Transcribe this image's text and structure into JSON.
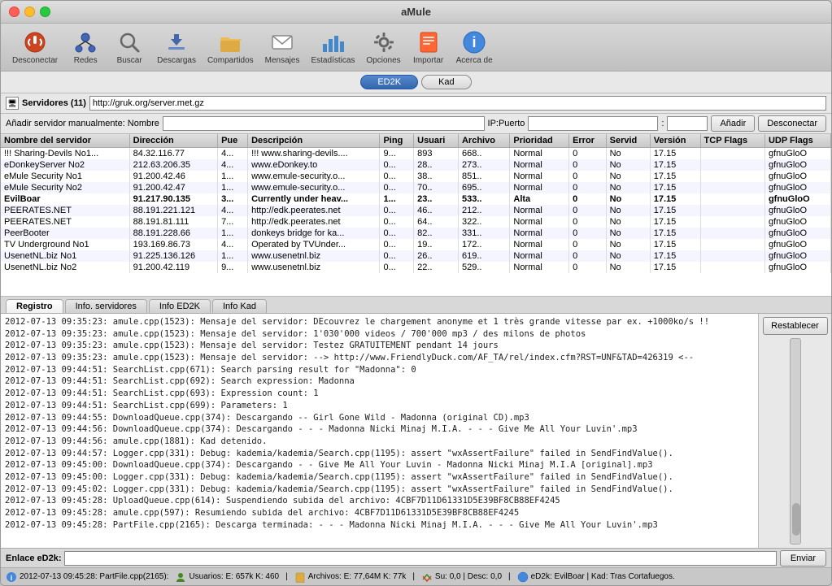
{
  "app": {
    "title": "aMule",
    "window_controls": [
      "close",
      "minimize",
      "maximize"
    ]
  },
  "toolbar": {
    "buttons": [
      {
        "id": "desconectar",
        "label": "Desconectar",
        "icon": "⏏"
      },
      {
        "id": "redes",
        "label": "Redes",
        "icon": "🌐"
      },
      {
        "id": "buscar",
        "label": "Buscar",
        "icon": "🔍"
      },
      {
        "id": "descargas",
        "label": "Descargas",
        "icon": "⬇"
      },
      {
        "id": "compartidos",
        "label": "Compartidos",
        "icon": "📁"
      },
      {
        "id": "mensajes",
        "label": "Mensajes",
        "icon": "✉"
      },
      {
        "id": "estadisticas",
        "label": "Estadísticas",
        "icon": "📊"
      },
      {
        "id": "opciones",
        "label": "Opciones",
        "icon": "🔧"
      },
      {
        "id": "importar",
        "label": "Importar",
        "icon": "📥"
      },
      {
        "id": "acerca",
        "label": "Acerca de",
        "icon": "ℹ"
      }
    ]
  },
  "network_bar": {
    "buttons": [
      "ED2K",
      "Kad"
    ],
    "active": "ED2K"
  },
  "server_bar": {
    "label": "Servidores (11)",
    "url": "http://gruk.org/server.met.gz"
  },
  "add_server": {
    "label": "Añadir servidor manualmente: Nombre",
    "ip_label": "IP:Puerto",
    "add_btn": "Añadir",
    "disconnect_btn": "Desconectar"
  },
  "servers_table": {
    "columns": [
      {
        "id": "nombre",
        "label": "Nombre del servidor",
        "width": 130
      },
      {
        "id": "direccion",
        "label": "Dirección",
        "width": 110
      },
      {
        "id": "puerto",
        "label": "Pue",
        "width": 30
      },
      {
        "id": "descripcion",
        "label": "Descripción",
        "width": 140
      },
      {
        "id": "ping",
        "label": "Ping",
        "width": 35
      },
      {
        "id": "usuarios",
        "label": "Usuari",
        "width": 40
      },
      {
        "id": "archivos",
        "label": "Archivo",
        "width": 45
      },
      {
        "id": "prioridad",
        "label": "Prioridad",
        "width": 55
      },
      {
        "id": "error",
        "label": "Error",
        "width": 35
      },
      {
        "id": "servidor",
        "label": "Servid",
        "width": 40
      },
      {
        "id": "version",
        "label": "Versión",
        "width": 45
      },
      {
        "id": "tcp",
        "label": "TCP Flags",
        "width": 60
      },
      {
        "id": "udp",
        "label": "UDP Flags",
        "width": 80
      }
    ],
    "rows": [
      {
        "nombre": "!!! Sharing-Devils No1...",
        "direccion": "84.32.116.77",
        "puerto": "4...",
        "descripcion": "!!! www.sharing-devils....",
        "ping": "9... ",
        "usuarios": "893",
        "archivos": "668..",
        "prioridad": "Normal",
        "error": "0",
        "servidor": "No",
        "version": "17.15",
        "tcp": "",
        "udp": "gfnuGloO",
        "bold": false
      },
      {
        "nombre": "eDonkeyServer No2",
        "direccion": "212.63.206.35",
        "puerto": "4...",
        "descripcion": "www.eDonkey.to",
        "ping": "0...",
        "usuarios": "28..",
        "archivos": "273..",
        "prioridad": "Normal",
        "error": "0",
        "servidor": "No",
        "version": "17.15",
        "tcp": "",
        "udp": "gfnuGloO",
        "bold": false
      },
      {
        "nombre": "eMule Security No1",
        "direccion": "91.200.42.46",
        "puerto": "1...",
        "descripcion": "www.emule-security.o...",
        "ping": "0...",
        "usuarios": "38..",
        "archivos": "851..",
        "prioridad": "Normal",
        "error": "0",
        "servidor": "No",
        "version": "17.15",
        "tcp": "",
        "udp": "gfnuGloO",
        "bold": false
      },
      {
        "nombre": "eMule Security No2",
        "direccion": "91.200.42.47",
        "puerto": "1...",
        "descripcion": "www.emule-security.o...",
        "ping": "0...",
        "usuarios": "70..",
        "archivos": "695..",
        "prioridad": "Normal",
        "error": "0",
        "servidor": "No",
        "version": "17.15",
        "tcp": "",
        "udp": "gfnuGloO",
        "bold": false
      },
      {
        "nombre": "EvilBoar",
        "direccion": "91.217.90.135",
        "puerto": "3...",
        "descripcion": "Currently under heav...",
        "ping": "1...",
        "usuarios": "23..",
        "archivos": "533..",
        "prioridad": "Alta",
        "error": "0",
        "servidor": "No",
        "version": "17.15",
        "tcp": "",
        "udp": "gfnuGloO",
        "bold": true
      },
      {
        "nombre": "PEERATES.NET",
        "direccion": "88.191.221.121",
        "puerto": "4...",
        "descripcion": "http://edk.peerates.net",
        "ping": "0...",
        "usuarios": "46..",
        "archivos": "212..",
        "prioridad": "Normal",
        "error": "0",
        "servidor": "No",
        "version": "17.15",
        "tcp": "",
        "udp": "gfnuGloO",
        "bold": false
      },
      {
        "nombre": "PEERATES.NET",
        "direccion": "88.191.81.111",
        "puerto": "7...",
        "descripcion": "http://edk.peerates.net",
        "ping": "0...",
        "usuarios": "64..",
        "archivos": "322..",
        "prioridad": "Normal",
        "error": "0",
        "servidor": "No",
        "version": "17.15",
        "tcp": "",
        "udp": "gfnuGloO",
        "bold": false
      },
      {
        "nombre": "PeerBooter",
        "direccion": "88.191.228.66",
        "puerto": "1...",
        "descripcion": "donkeys bridge for ka...",
        "ping": "0...",
        "usuarios": "82..",
        "archivos": "331..",
        "prioridad": "Normal",
        "error": "0",
        "servidor": "No",
        "version": "17.15",
        "tcp": "",
        "udp": "gfnuGloO",
        "bold": false
      },
      {
        "nombre": "TV Underground No1",
        "direccion": "193.169.86.73",
        "puerto": "4...",
        "descripcion": "Operated by TVUnder...",
        "ping": "0...",
        "usuarios": "19..",
        "archivos": "172..",
        "prioridad": "Normal",
        "error": "0",
        "servidor": "No",
        "version": "17.15",
        "tcp": "",
        "udp": "gfnuGloO",
        "bold": false
      },
      {
        "nombre": "UsenetNL.biz No1",
        "direccion": "91.225.136.126",
        "puerto": "1...",
        "descripcion": "www.usenetnl.biz",
        "ping": "0...",
        "usuarios": "26..",
        "archivos": "619..",
        "prioridad": "Normal",
        "error": "0",
        "servidor": "No",
        "version": "17.15",
        "tcp": "",
        "udp": "gfnuGloO",
        "bold": false
      },
      {
        "nombre": "UsenetNL.biz No2",
        "direccion": "91.200.42.119",
        "puerto": "9...",
        "descripcion": "www.usenetnl.biz",
        "ping": "0...",
        "usuarios": "22..",
        "archivos": "529..",
        "prioridad": "Normal",
        "error": "0",
        "servidor": "No",
        "version": "17.15",
        "tcp": "",
        "udp": "gfnuGloO",
        "bold": false
      }
    ]
  },
  "log_tabs": [
    "Registro",
    "Info. servidores",
    "Info ED2K",
    "Info Kad"
  ],
  "log_active_tab": "Registro",
  "log_entries": [
    "2012-07-13 09:35:23: amule.cpp(1523): Mensaje del servidor: DEcouvrez le chargement anonyme et 1 très grande vitesse par ex. +1000ko/s !!",
    "2012-07-13 09:35:23: amule.cpp(1523): Mensaje del servidor: 1'030'000 videos / 700'000 mp3 / des milons de photos",
    "2012-07-13 09:35:23: amule.cpp(1523): Mensaje del servidor: Testez GRATUITEMENT pendant 14 jours",
    "2012-07-13 09:35:23: amule.cpp(1523): Mensaje del servidor: --> http://www.FriendlyDuck.com/AF_TA/rel/index.cfm?RST=UNF&TAD=426319 <--",
    "2012-07-13 09:44:51: SearchList.cpp(671): Search parsing result for \"Madonna\": 0",
    "2012-07-13 09:44:51: SearchList.cpp(692): Search expression: Madonna",
    "2012-07-13 09:44:51: SearchList.cpp(693): Expression count: 1",
    "2012-07-13 09:44:51: SearchList.cpp(699): Parameters: 1",
    "2012-07-13 09:44:55: DownloadQueue.cpp(374): Descargando -- Girl Gone Wild - Madonna (original CD).mp3",
    "2012-07-13 09:44:56: DownloadQueue.cpp(374): Descargando - - - Madonna Nicki Minaj M.I.A. - - - Give Me All Your Luvin'.mp3",
    "2012-07-13 09:44:56: amule.cpp(1881): Kad detenido.",
    "2012-07-13 09:44:57: Logger.cpp(331): Debug: kademia/kademia/Search.cpp(1195): assert \"wxAssertFailure\" failed in SendFindValue().",
    "2012-07-13 09:45:00: DownloadQueue.cpp(374): Descargando - - Give Me All Your Luvin - Madonna Nicki Minaj M.I.A [original].mp3",
    "2012-07-13 09:45:00: Logger.cpp(331): Debug: kademia/kademia/Search.cpp(1195): assert \"wxAssertFailure\" failed in SendFindValue().",
    "2012-07-13 09:45:02: Logger.cpp(331): Debug: kademia/kademia/Search.cpp(1195): assert \"wxAssertFailure\" failed in SendFindValue().",
    "2012-07-13 09:45:28: UploadQueue.cpp(614): Suspendiendo subida del archivo: 4CBF7D11D61331D5E39BF8CB88EF4245",
    "2012-07-13 09:45:28: amule.cpp(597): Resumiendo subida del archivo: 4CBF7D11D61331D5E39BF8CB88EF4245",
    "2012-07-13 09:45:28: PartFile.cpp(2165): Descarga terminada: - - - Madonna Nicki Minaj M.I.A. - - - Give Me All Your Luvin'.mp3"
  ],
  "log_sidebar": {
    "restablecer_btn": "Restablecer"
  },
  "enlace": {
    "label": "Enlace eD2k:",
    "enviar_btn": "Enviar"
  },
  "bottom_status": {
    "log_entry": "2012-07-13 09:45:28: PartFile.cpp(2165):",
    "usuarios": "Usuarios: E: 657k K: 460",
    "archivos": "Archivos: E: 77,64M K: 77k",
    "su": "Su: 0,0 | Desc: 0,0",
    "ed2k": "eD2k: EvilBoar | Kad: Tras Cortafuegos."
  }
}
